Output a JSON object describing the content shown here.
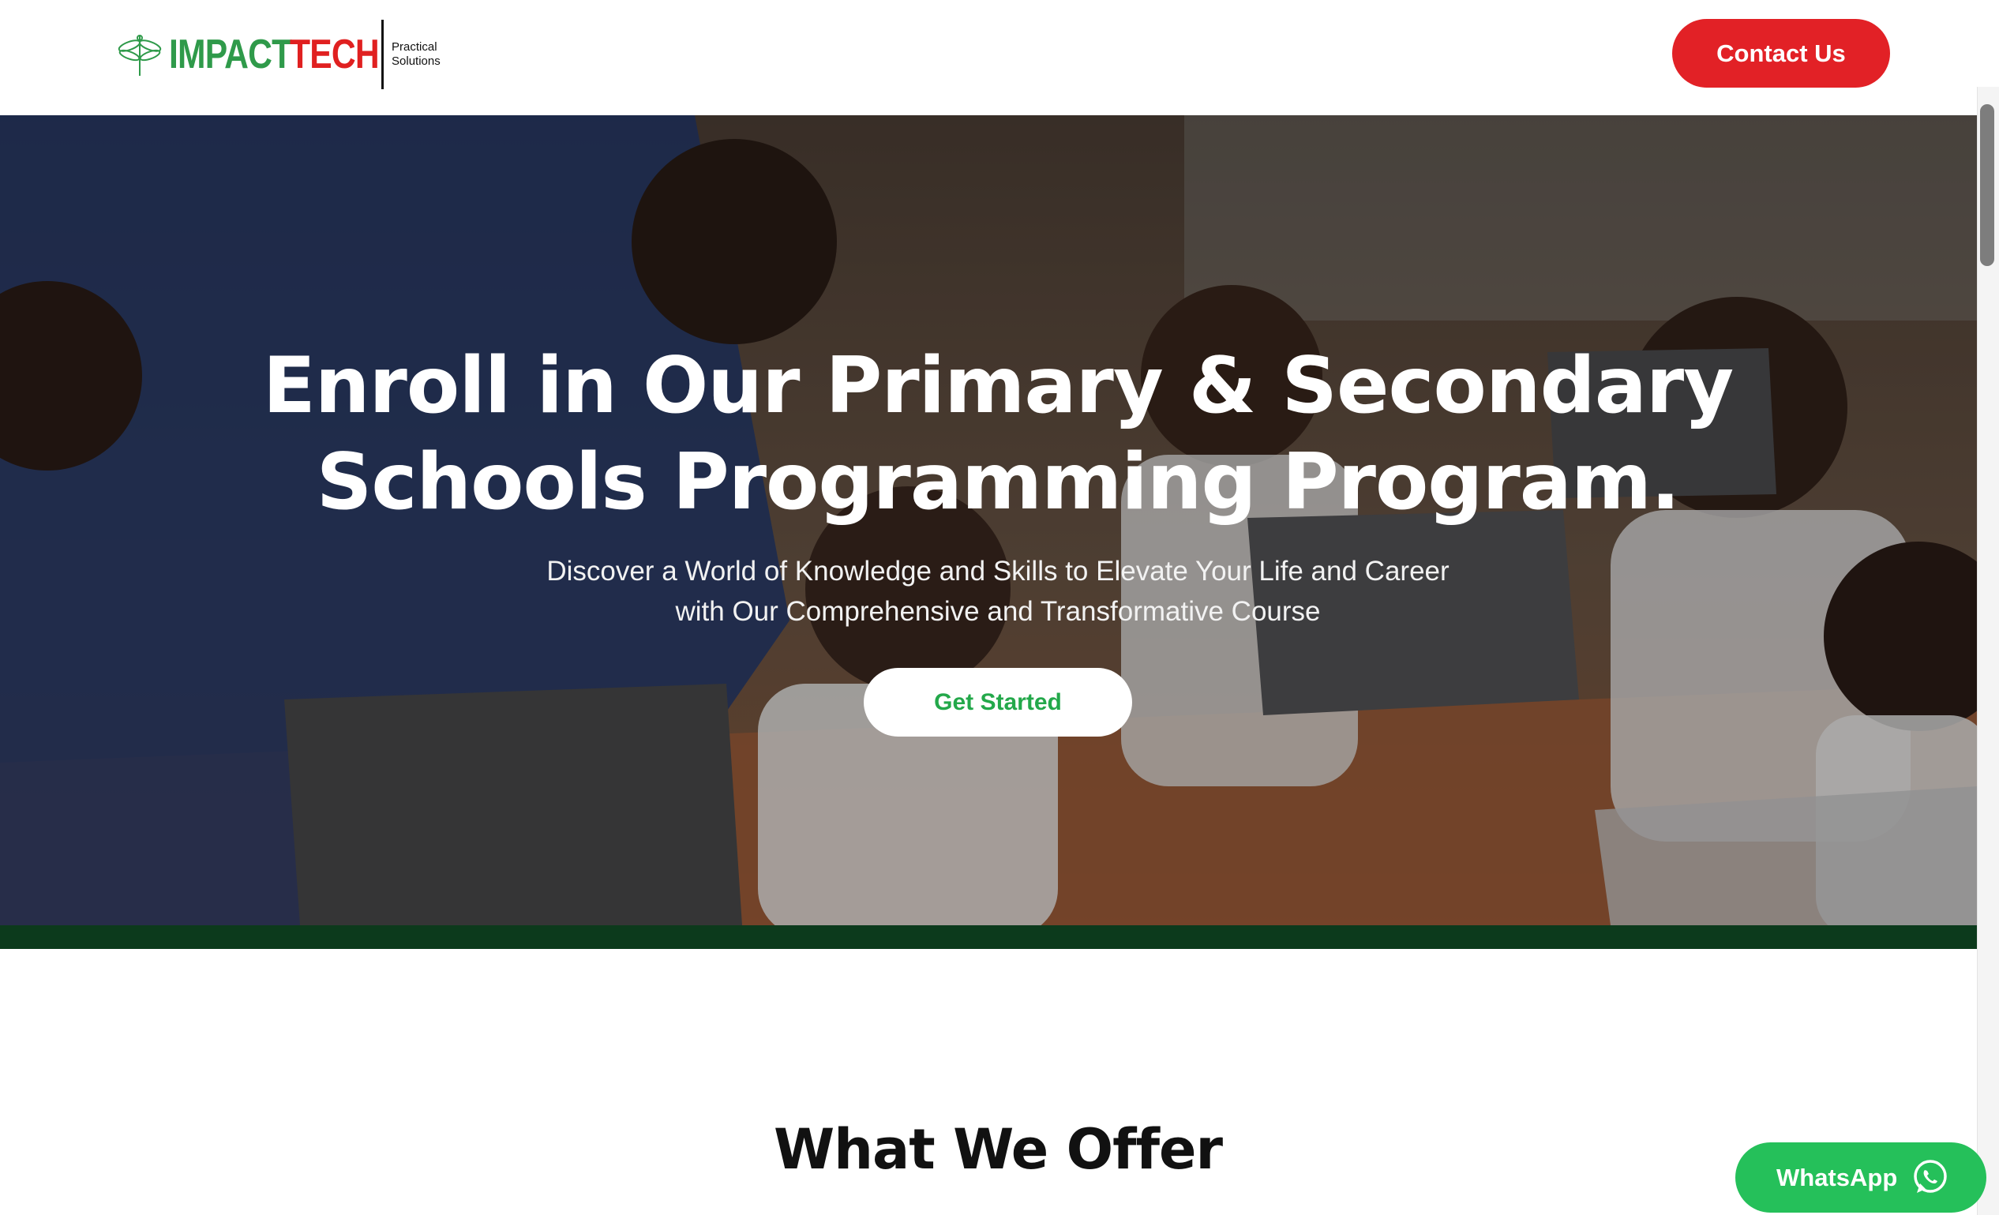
{
  "header": {
    "brand_word1": "IMPACT",
    "brand_word2": "TECH",
    "tagline_line1": "Practical",
    "tagline_line2": "Solutions",
    "logo_icon": "dragonfly-icon",
    "contact_label": "Contact Us"
  },
  "hero": {
    "title_line1": "Enroll in Our Primary & Secondary",
    "title_line2": "Schools Programming Program.",
    "subtitle_line1": "Discover a World of Knowledge and Skills to Elevate Your Life and Career",
    "subtitle_line2": "with Our Comprehensive and Transformative Course",
    "cta_label": "Get Started"
  },
  "offer": {
    "title": "What We Offer"
  },
  "whatsapp": {
    "label": "WhatsApp",
    "icon": "whatsapp-icon"
  },
  "colors": {
    "brand_green": "#2f9a4a",
    "brand_red": "#e02020",
    "contact_button": "#e22126",
    "whatsapp_button": "#25c05a",
    "cta_text": "#23a84a",
    "band": "#0c3a1c"
  }
}
